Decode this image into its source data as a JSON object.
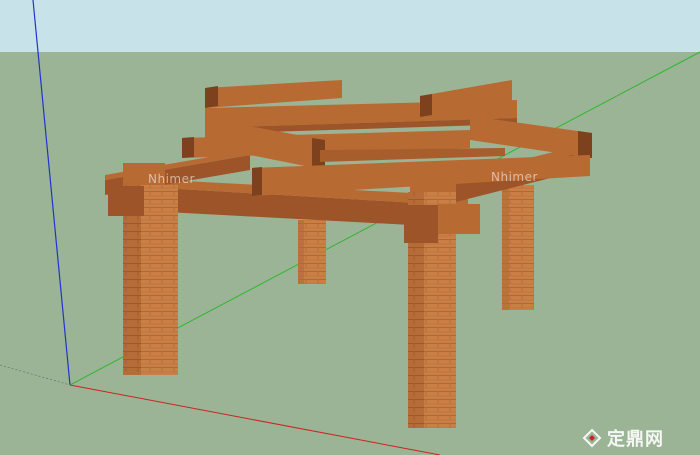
{
  "scene": {
    "colors": {
      "sky": "#c7e3e9",
      "ground": "#9bb496",
      "wood_top": "#b86a33",
      "wood_side": "#9c5428",
      "wood_dark": "#7d421d",
      "brick": "#c97f45",
      "brick_dark": "#a9642f",
      "axis_green": "#2eb82e",
      "axis_blue": "#2233cc",
      "axis_red": "#cc2222"
    }
  },
  "watermarks": {
    "left": "Nhimer",
    "right": "Nhimer"
  },
  "brand": {
    "text": "定鼎网",
    "logo_icon": "diamond-logo-icon"
  }
}
